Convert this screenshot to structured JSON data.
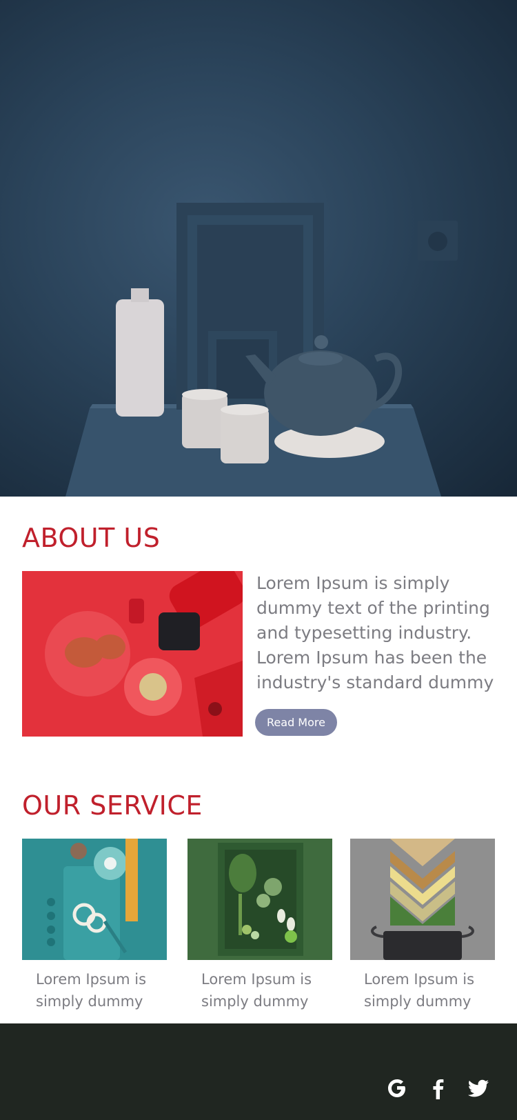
{
  "about": {
    "title": "ABOUT US",
    "body": "Lorem Ipsum is simply dummy text of the printing and typesetting industry. Lorem Ipsum has been the industry's standard dummy",
    "read_more_label": "Read More"
  },
  "service": {
    "title": "OUR SERVICE",
    "items": [
      {
        "caption": "Lorem Ipsum is simply dummy"
      },
      {
        "caption": "Lorem Ipsum is simply dummy"
      },
      {
        "caption": "Lorem Ipsum is simply dummy"
      }
    ]
  },
  "footer": {
    "social_icons": [
      "google-icon",
      "facebook-icon",
      "twitter-icon"
    ]
  },
  "colors": {
    "heading": "#c0202c",
    "body_text": "#7c7c82",
    "button": "#7e84a6",
    "footer": "#202621"
  }
}
